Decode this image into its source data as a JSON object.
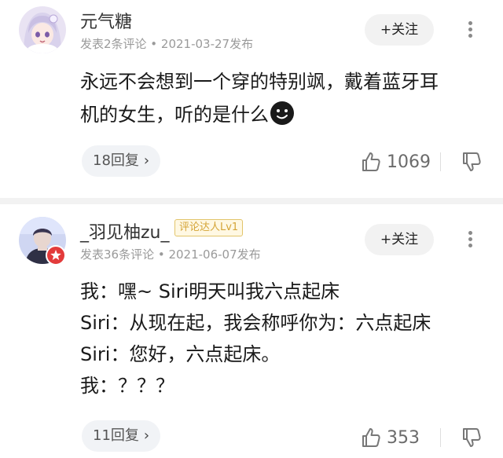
{
  "comments": [
    {
      "username": "元气糖",
      "meta": "发表2条评论 • 2021-03-27发布",
      "follow_label": "+关注",
      "body_lines": [
        "永远不会想到一个穿的特别飒，戴着蓝牙耳",
        "机的女生，听的是什么"
      ],
      "emoji_icon": "smirk-face-icon",
      "replies_label": "18回复",
      "likes": "1069"
    },
    {
      "username": "_羽见柚zu_",
      "badge": "评论达人Lv1",
      "meta": "发表36条评论 • 2021-06-07发布",
      "follow_label": "+关注",
      "body_lines": [
        "我：嘿~ Siri明天叫我六点起床",
        "Siri：从现在起，我会称呼你为：六点起床",
        "Siri：您好，六点起床。",
        "我：？？？"
      ],
      "replies_label": "11回复",
      "likes": "353"
    }
  ],
  "colors": {
    "badge_border": "#e2c46a",
    "badge_text": "#d4a437",
    "meta_text": "#9a9a9a",
    "pill_bg": "#f1f3f6"
  }
}
